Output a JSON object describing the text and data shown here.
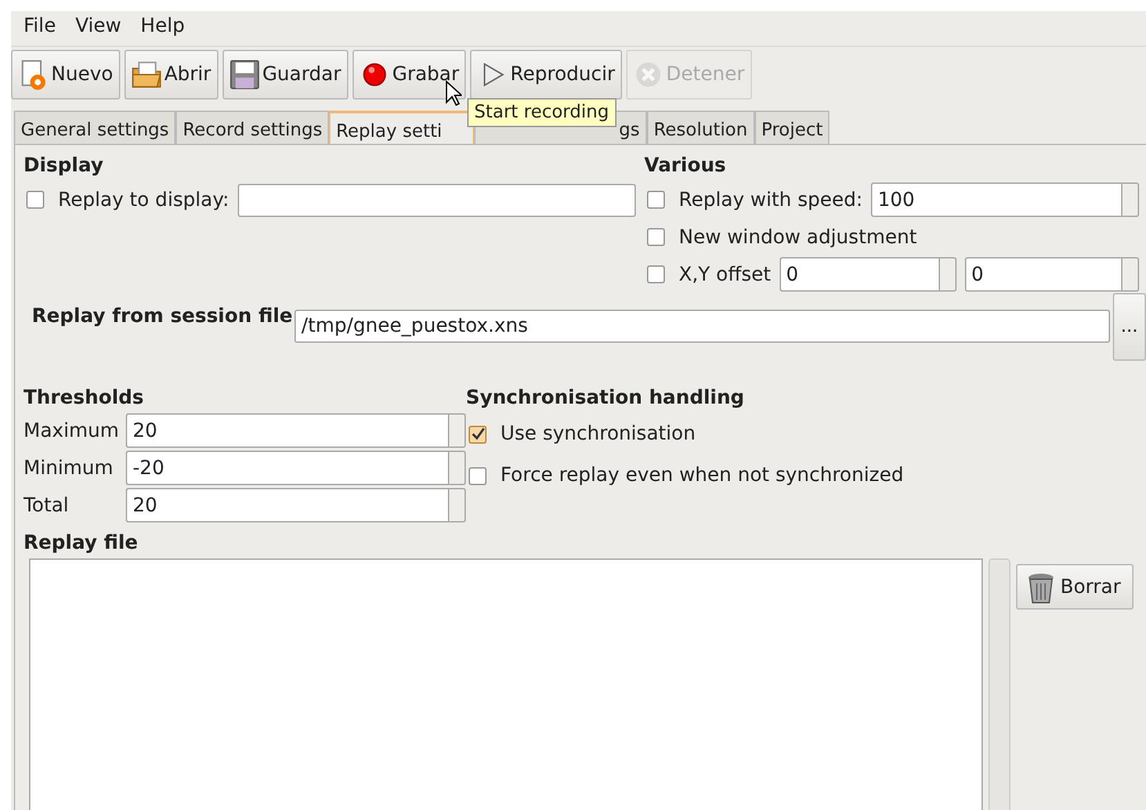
{
  "menu": [
    "File",
    "View",
    "Help"
  ],
  "toolbar": [
    {
      "label": "Nuevo",
      "kind": "new",
      "disabled": false
    },
    {
      "label": "Abrir",
      "kind": "open",
      "disabled": false
    },
    {
      "label": "Guardar",
      "kind": "save",
      "disabled": false
    },
    {
      "label": "Grabar",
      "kind": "record",
      "disabled": false
    },
    {
      "label": "Reproducir",
      "kind": "play",
      "disabled": false
    },
    {
      "label": "Detener",
      "kind": "stop",
      "disabled": true
    }
  ],
  "tabs": [
    {
      "label": "General settings",
      "selected": false
    },
    {
      "label": "Record settings",
      "selected": false
    },
    {
      "label": "Replay setti",
      "selected": true
    },
    {
      "label": "gs",
      "selected": false
    },
    {
      "label": "Resolution",
      "selected": false
    },
    {
      "label": "Project",
      "selected": false
    }
  ],
  "tooltip": "Start recording",
  "display": {
    "heading": "Display",
    "label": "Replay to display:",
    "checked": false
  },
  "various": {
    "heading": "Various",
    "rows": [
      {
        "kind": "spin",
        "label": "Replay with speed:",
        "checked": false,
        "values": [
          "100"
        ]
      },
      {
        "kind": "check",
        "label": "New window adjustment",
        "checked": false
      },
      {
        "kind": "offset",
        "label": "X,Y offset",
        "checked": false,
        "values": [
          "0",
          "0"
        ]
      }
    ]
  },
  "session": {
    "heading": "Replay from session file",
    "value": "/tmp/gnee_puestox.xns",
    "browse": "..."
  },
  "thresholds": {
    "heading": "Thresholds",
    "rows": [
      {
        "label": "Maximum",
        "value": "20"
      },
      {
        "label": "Minimum",
        "value": "-20"
      },
      {
        "label": "Total",
        "value": "20"
      }
    ]
  },
  "sync": {
    "heading": "Synchronisation handling",
    "options": [
      {
        "label": "Use synchronisation",
        "checked": true
      },
      {
        "label": "Force replay even when not synchronized",
        "checked": false
      }
    ]
  },
  "replay_file": {
    "heading": "Replay file",
    "clear": "Borrar"
  }
}
